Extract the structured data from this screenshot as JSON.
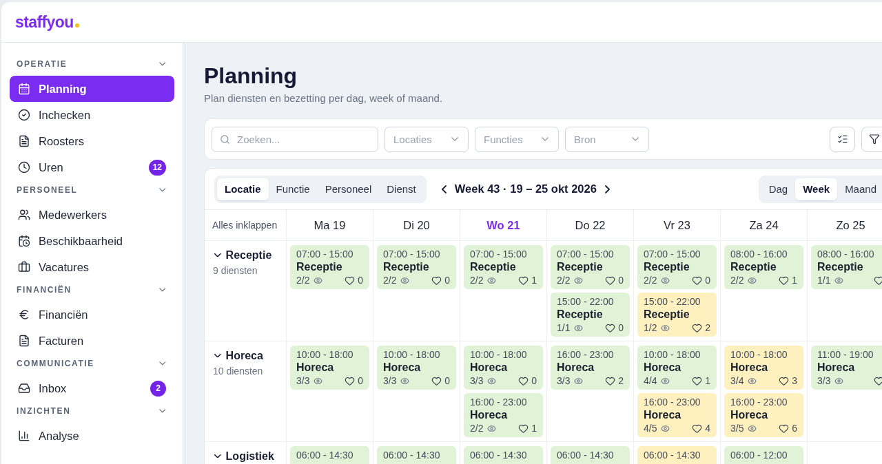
{
  "app": {
    "logo": "staffyou"
  },
  "sidebar": {
    "sections": [
      {
        "title": "OPERATIE",
        "expanded": true,
        "items": [
          {
            "label": "Planning",
            "selected": true
          },
          {
            "label": "Inchecken",
            "selected": false
          },
          {
            "label": "Roosters",
            "selected": false
          },
          {
            "label": "Uren",
            "selected": false,
            "badge": "12"
          }
        ]
      },
      {
        "title": "PERSONEEL",
        "expanded": true,
        "items": [
          {
            "label": "Medewerkers",
            "selected": false
          },
          {
            "label": "Beschikbaarheid",
            "selected": false
          },
          {
            "label": "Vacatures",
            "selected": false
          }
        ]
      },
      {
        "title": "FINANCIËN",
        "expanded": true,
        "items": [
          {
            "label": "Financiën",
            "selected": false
          },
          {
            "label": "Facturen",
            "selected": false
          }
        ]
      },
      {
        "title": "COMMUNICATIE",
        "expanded": true,
        "items": [
          {
            "label": "Inbox",
            "selected": false,
            "badge": "2"
          }
        ]
      },
      {
        "title": "INZICHTEN",
        "expanded": true,
        "items": [
          {
            "label": "Analyse",
            "selected": false
          }
        ]
      }
    ]
  },
  "page": {
    "title": "Planning",
    "subtitle": "Plan diensten en bezetting per dag, week of maand."
  },
  "filters": {
    "search": {
      "placeholder": "Zoeken..."
    },
    "dropdowns": [
      {
        "placeholder": "Locaties"
      },
      {
        "placeholder": "Functies"
      },
      {
        "placeholder": "Bron"
      }
    ]
  },
  "planning": {
    "group_tabs": [
      {
        "label": "Locatie",
        "selected": true
      },
      {
        "label": "Functie",
        "selected": false
      },
      {
        "label": "Personeel",
        "selected": false
      },
      {
        "label": "Dienst",
        "selected": false
      }
    ],
    "period": "Week 43 · 19 – 25 okt 2026",
    "view_tabs": [
      {
        "label": "Dag",
        "selected": false
      },
      {
        "label": "Week",
        "selected": true
      },
      {
        "label": "Maand",
        "selected": false
      }
    ],
    "collapse_label": "Alles inklappen",
    "days": [
      {
        "label": "Ma 19",
        "today": false
      },
      {
        "label": "Di 20",
        "today": false
      },
      {
        "label": "Wo 21",
        "today": true
      },
      {
        "label": "Do 22",
        "today": false
      },
      {
        "label": "Vr 23",
        "today": false
      },
      {
        "label": "Za 24",
        "today": false
      },
      {
        "label": "Zo 25",
        "today": false
      }
    ],
    "groups": [
      {
        "name": "Receptie",
        "expanded": true,
        "count": "9 diensten",
        "cells": [
          {
            "shifts": [
              {
                "time": "07:00 - 15:00",
                "role": "Receptie",
                "filled": "2/2",
                "likes": "0",
                "color": "#e1f3d7"
              }
            ]
          },
          {
            "shifts": [
              {
                "time": "07:00 - 15:00",
                "role": "Receptie",
                "filled": "2/2",
                "likes": "0",
                "color": "#e1f3d7"
              }
            ]
          },
          {
            "shifts": [
              {
                "time": "07:00 - 15:00",
                "role": "Receptie",
                "filled": "2/2",
                "likes": "1",
                "color": "#e1f3d7"
              }
            ]
          },
          {
            "shifts": [
              {
                "time": "07:00 - 15:00",
                "role": "Receptie",
                "filled": "2/2",
                "likes": "0",
                "color": "#e1f3d7"
              },
              {
                "time": "15:00 - 22:00",
                "role": "Receptie",
                "filled": "1/1",
                "likes": "0",
                "color": "#e1f3d7"
              }
            ]
          },
          {
            "shifts": [
              {
                "time": "07:00 - 15:00",
                "role": "Receptie",
                "filled": "2/2",
                "likes": "0",
                "color": "#e1f3d7"
              },
              {
                "time": "15:00 - 22:00",
                "role": "Receptie",
                "filled": "1/2",
                "likes": "2",
                "color": "#fef1bf"
              }
            ]
          },
          {
            "shifts": [
              {
                "time": "08:00 - 16:00",
                "role": "Receptie",
                "filled": "2/2",
                "likes": "1",
                "color": "#e1f3d7"
              }
            ]
          },
          {
            "shifts": [
              {
                "time": "08:00 - 16:00",
                "role": "Receptie",
                "filled": "1/1",
                "color": "#e1f3d7"
              }
            ]
          }
        ]
      },
      {
        "name": "Horeca",
        "expanded": true,
        "count": "10 diensten",
        "cells": [
          {
            "shifts": [
              {
                "time": "10:00 - 18:00",
                "role": "Horeca",
                "filled": "3/3",
                "likes": "0",
                "color": "#e1f3d7"
              }
            ]
          },
          {
            "shifts": [
              {
                "time": "10:00 - 18:00",
                "role": "Horeca",
                "filled": "3/3",
                "likes": "0",
                "color": "#e1f3d7"
              }
            ]
          },
          {
            "shifts": [
              {
                "time": "10:00 - 18:00",
                "role": "Horeca",
                "filled": "3/3",
                "likes": "0",
                "color": "#e1f3d7"
              },
              {
                "time": "16:00 - 23:00",
                "role": "Horeca",
                "filled": "2/2",
                "likes": "1",
                "color": "#e1f3d7"
              }
            ]
          },
          {
            "shifts": [
              {
                "time": "16:00 - 23:00",
                "role": "Horeca",
                "filled": "3/3",
                "likes": "2",
                "color": "#e1f3d7"
              }
            ]
          },
          {
            "shifts": [
              {
                "time": "10:00 - 18:00",
                "role": "Horeca",
                "filled": "4/4",
                "likes": "1",
                "color": "#e1f3d7"
              },
              {
                "time": "16:00 - 23:00",
                "role": "Horeca",
                "filled": "4/5",
                "likes": "4",
                "color": "#fef1bf"
              }
            ]
          },
          {
            "shifts": [
              {
                "time": "10:00 - 18:00",
                "role": "Horeca",
                "filled": "3/4",
                "likes": "3",
                "color": "#fef1bf"
              },
              {
                "time": "16:00 - 23:00",
                "role": "Horeca",
                "filled": "3/5",
                "likes": "6",
                "color": "#fef1bf"
              }
            ]
          },
          {
            "shifts": [
              {
                "time": "11:00 - 19:00",
                "role": "Horeca",
                "filled": "3/3",
                "color": "#e1f3d7"
              }
            ]
          }
        ]
      },
      {
        "name": "Logistiek",
        "expanded": true,
        "cells": [
          {
            "shifts": [
              {
                "time": "06:00 - 14:30",
                "color": "#e1f3d7"
              }
            ]
          },
          {
            "shifts": [
              {
                "time": "06:00 - 14:30",
                "color": "#e1f3d7"
              }
            ]
          },
          {
            "shifts": [
              {
                "time": "06:00 - 14:30",
                "color": "#e1f3d7"
              }
            ]
          },
          {
            "shifts": [
              {
                "time": "06:00 - 14:30",
                "color": "#e1f3d7"
              }
            ]
          },
          {
            "shifts": [
              {
                "time": "06:00 - 14:30",
                "color": "#fef1bf"
              }
            ]
          },
          {
            "shifts": [
              {
                "time": "06:00 - 12:00",
                "color": "#e1f3d7"
              }
            ]
          }
        ]
      }
    ]
  }
}
